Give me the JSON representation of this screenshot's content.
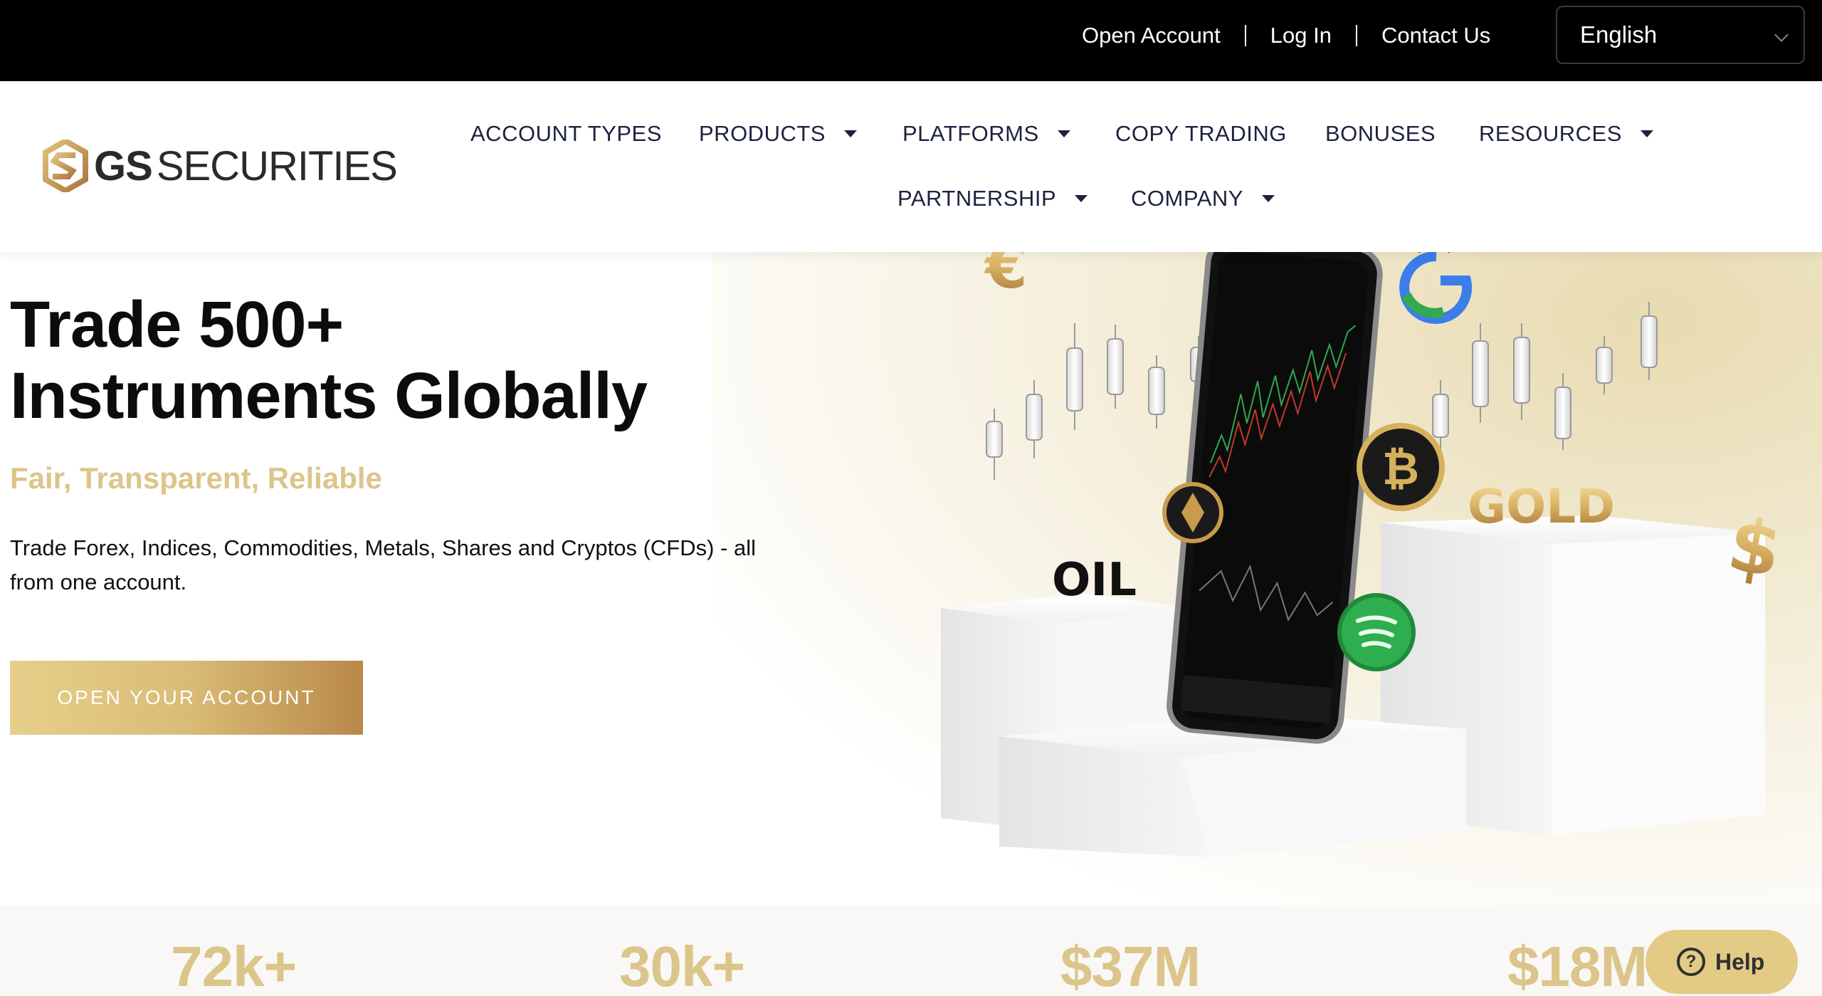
{
  "topbar": {
    "links": [
      "Open Account",
      "Log In",
      "Contact Us"
    ],
    "language": "English"
  },
  "header": {
    "logo": {
      "bold": "GS",
      "light": "SECURITIES"
    },
    "nav": {
      "account_types": "ACCOUNT TYPES",
      "products": "PRODUCTS",
      "platforms": "PLATFORMS",
      "copy_trading": "COPY TRADING",
      "bonuses": "BONUSES",
      "resources": "RESOURCES",
      "partnership": "PARTNERSHIP",
      "company": "COMPANY"
    }
  },
  "hero": {
    "title_line1": "Trade 500+",
    "title_line2": "Instruments Globally",
    "tagline": "Fair, Transparent, Reliable",
    "description": "Trade Forex, Indices, Commodities, Metals, Shares and Cryptos (CFDs) - all from one account.",
    "cta": "OPEN YOUR ACCOUNT",
    "illustration": {
      "oil_label": "OIL",
      "gold_label": "GOLD",
      "dollar_symbol": "$",
      "euro_symbol": "€",
      "bitcoin_symbol": "₿"
    }
  },
  "stats": [
    "72k+",
    "30k+",
    "$37M",
    "$18M"
  ],
  "help": {
    "label": "Help",
    "icon": "?"
  },
  "colors": {
    "gold": "#dcc58a",
    "navy": "#1d2240",
    "black": "#000000"
  }
}
